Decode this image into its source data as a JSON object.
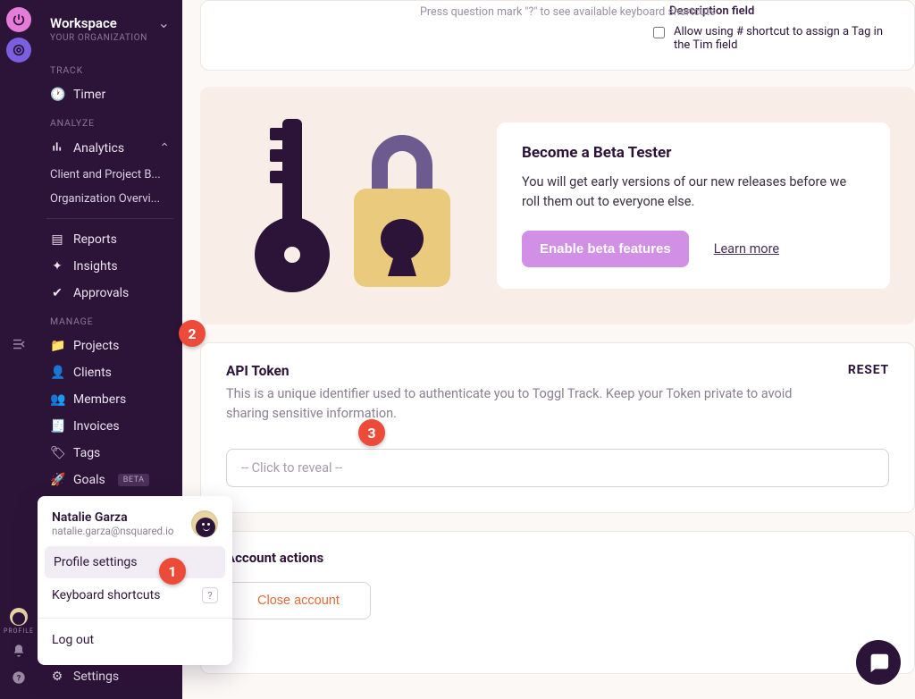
{
  "rail": {
    "profile_label": "PROFILE"
  },
  "workspace": {
    "title": "Workspace",
    "subtitle": "YOUR ORGANIZATION"
  },
  "sections": {
    "track": "TRACK",
    "analyze": "ANALYZE",
    "manage": "MANAGE"
  },
  "nav": {
    "timer": "Timer",
    "analytics": "Analytics",
    "sub1": "Client and Project B...",
    "sub2": "Organization Overvi...",
    "reports": "Reports",
    "insights": "Insights",
    "approvals": "Approvals",
    "projects": "Projects",
    "clients": "Clients",
    "members": "Members",
    "invoices": "Invoices",
    "tags": "Tags",
    "goals": "Goals",
    "goals_tag": "BETA",
    "settings": "Settings"
  },
  "hint": "Press question mark \"?\" to see available keyboard shortcuts",
  "top_card": {
    "description_label": "Description field",
    "checkbox_label": "Allow using # shortcut to assign a Tag in the Tim field"
  },
  "beta": {
    "title": "Become a Beta Tester",
    "text": "You will get early versions of our new releases before we roll them out to everyone else.",
    "button": "Enable beta features",
    "learn": "Learn more"
  },
  "api": {
    "title": "API Token",
    "desc": "This is a unique identifier used to authenticate you to Toggl Track. Keep your Token private to avoid sharing sensitive information.",
    "reset": "RESET",
    "placeholder": "-- Click to reveal --"
  },
  "account": {
    "title": "Account actions",
    "close_button": "Close account"
  },
  "popup": {
    "name": "Natalie Garza",
    "email": "natalie.garza@nsquared.io",
    "profile_settings": "Profile settings",
    "keyboard_shortcuts": "Keyboard shortcuts",
    "shortcut_key": "?",
    "logout": "Log out"
  },
  "callouts": {
    "one": "1",
    "two": "2",
    "three": "3"
  }
}
